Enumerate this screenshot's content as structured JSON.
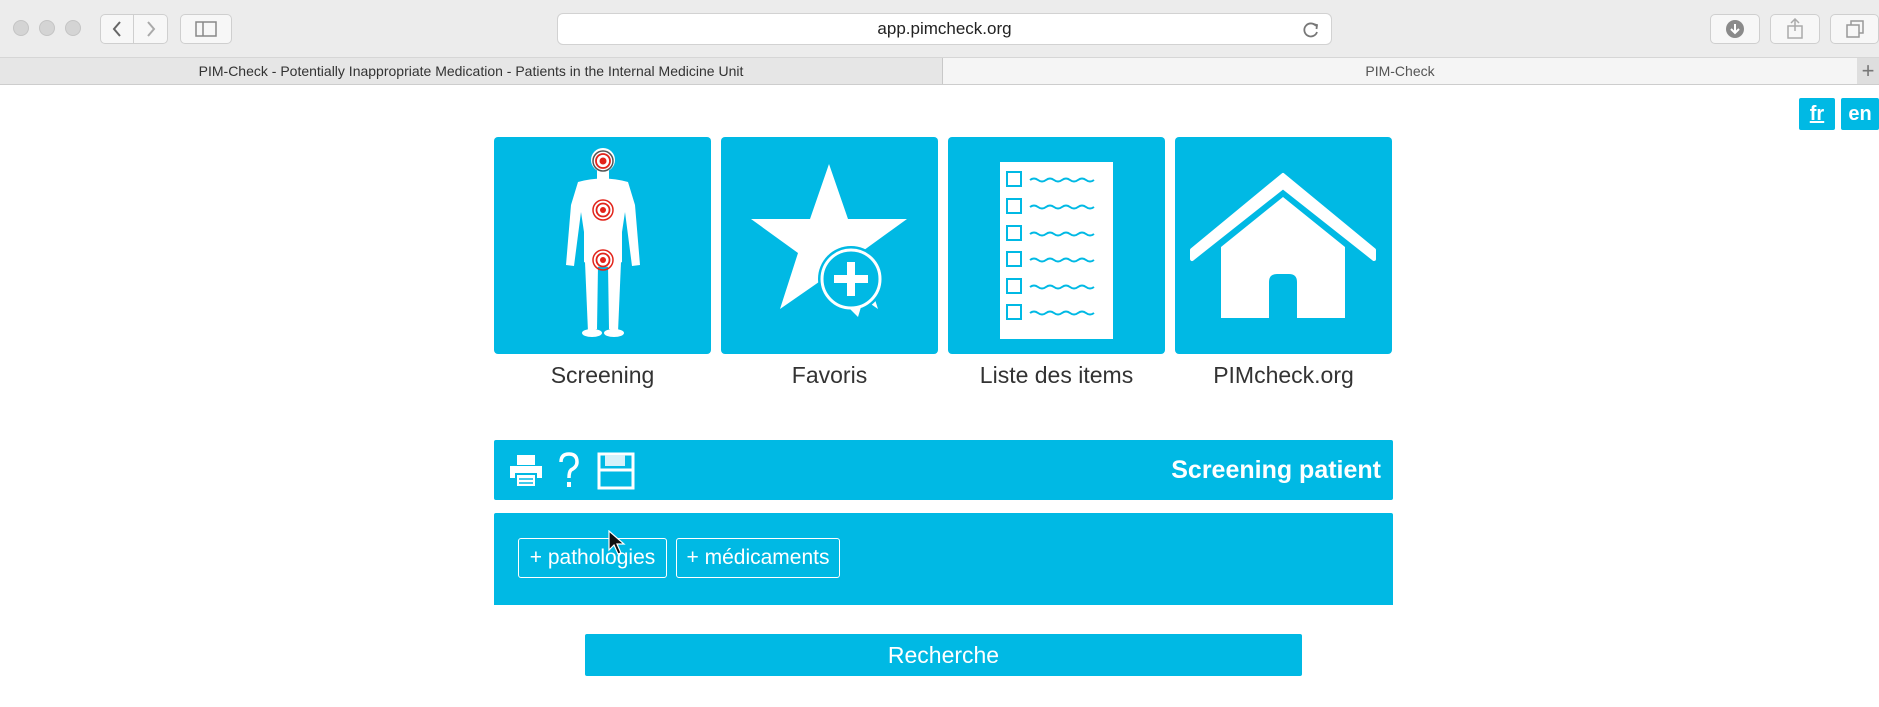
{
  "browser": {
    "url": "app.pimcheck.org",
    "tabs": [
      {
        "label": "PIM-Check - Potentially Inappropriate Medication - Patients in the Internal Medicine Unit",
        "active": false
      },
      {
        "label": "PIM-Check",
        "active": true
      }
    ],
    "new_tab_label": "+"
  },
  "language": {
    "fr": "fr",
    "en": "en",
    "selected": "fr"
  },
  "tiles": [
    {
      "label": "Screening",
      "icon": "body-screening-icon"
    },
    {
      "label": "Favoris",
      "icon": "star-plus-icon"
    },
    {
      "label": "Liste des items",
      "icon": "checklist-icon"
    },
    {
      "label": "PIMcheck.org",
      "icon": "home-icon"
    }
  ],
  "panel": {
    "title": "Screening patient",
    "icons": [
      "print-icon",
      "help-icon",
      "save-icon"
    ],
    "add_pathologies": "+ pathologies",
    "add_medicaments": "+ médicaments"
  },
  "search_label": "Recherche",
  "colors": {
    "accent": "#00b9e4",
    "target": "#e2231a"
  }
}
